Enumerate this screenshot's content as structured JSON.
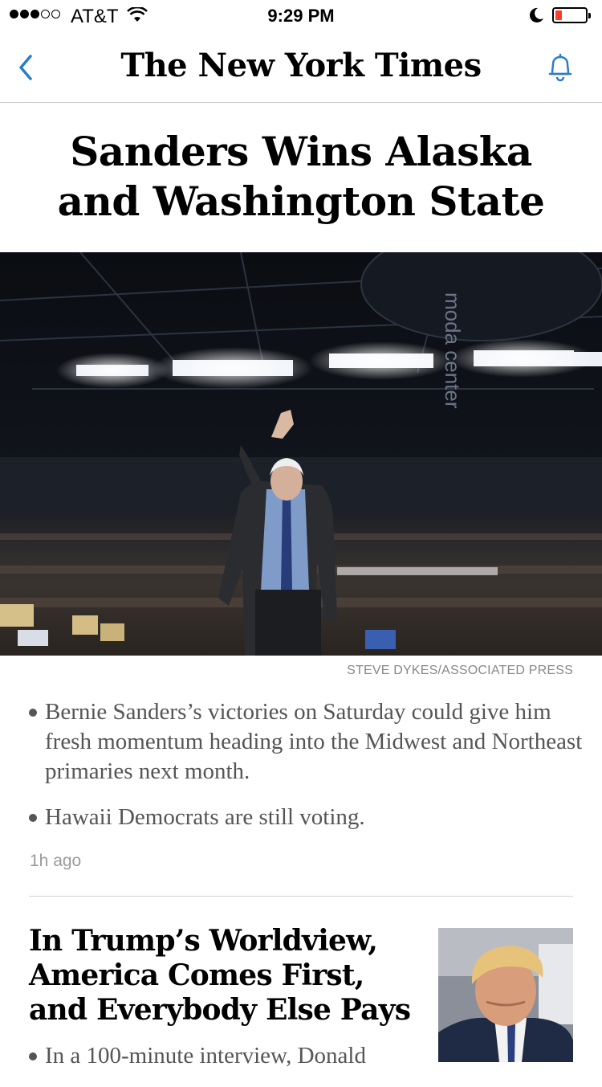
{
  "status_bar": {
    "carrier": "AT&T",
    "time": "9:29 PM"
  },
  "nav": {
    "masthead": "The New York Times",
    "back_icon": "chevron-left-icon",
    "bell_icon": "bell-icon"
  },
  "article": {
    "headline": "Sanders Wins Alaska and Washington State",
    "photo_credit": "STEVE DYKES/ASSOCIATED PRESS",
    "arena_sign": "moda center",
    "summary": [
      "Bernie Sanders’s victories on Saturday could give him fresh momentum heading into the Midwest and Northeast primaries next month.",
      "Hawaii Democrats are still voting."
    ],
    "timestamp": "1h ago"
  },
  "next_story": {
    "title": "In Trump’s Worldview, America Comes First, and Everybody Else Pays",
    "summary": "In a 100-minute interview, Donald"
  },
  "colors": {
    "accent": "#2a7ec8",
    "battery_low": "#ff3b30"
  }
}
